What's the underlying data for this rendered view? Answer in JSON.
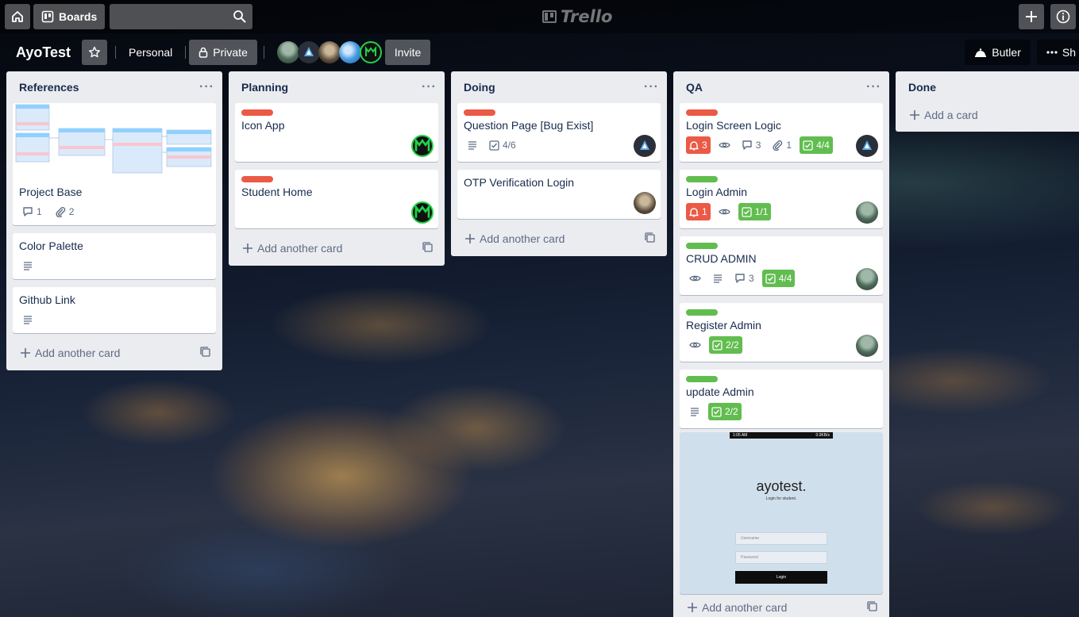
{
  "top_header": {
    "boards_label": "Boards",
    "search_placeholder": "",
    "logo_text": "Trello"
  },
  "board": {
    "title": "AyoTest",
    "team_label": "Personal",
    "visibility_label": "Private",
    "invite_label": "Invite",
    "butler_label": "Butler",
    "show_menu_label": "Sh"
  },
  "lists": [
    {
      "title": "References",
      "add_label": "Add another card",
      "cards": [
        {
          "title": "Project Base",
          "comments": "1",
          "attachments": "2"
        },
        {
          "title": "Color Palette"
        },
        {
          "title": "Github Link"
        }
      ]
    },
    {
      "title": "Planning",
      "add_label": "Add another card",
      "cards": [
        {
          "title": "Icon App",
          "label_color": "#eb5a46"
        },
        {
          "title": "Student Home",
          "label_color": "#eb5a46"
        }
      ]
    },
    {
      "title": "Doing",
      "add_label": "Add another card",
      "cards": [
        {
          "title": "Question Page [Bug Exist]",
          "label_color": "#eb5a46",
          "checklist": "4/6"
        },
        {
          "title": "OTP Verification Login"
        }
      ]
    },
    {
      "title": "QA",
      "add_label": "Add another card",
      "cards": [
        {
          "title": "Login Screen Logic",
          "label_color": "#eb5a46",
          "due": "3",
          "comments": "3",
          "attachments": "1",
          "checklist": "4/4"
        },
        {
          "title": "Login Admin",
          "label_color": "#61bd4f",
          "due": "1",
          "checklist": "1/1"
        },
        {
          "title": "CRUD ADMIN",
          "label_color": "#61bd4f",
          "comments": "3",
          "checklist": "4/4"
        },
        {
          "title": "Register Admin",
          "label_color": "#61bd4f",
          "checklist": "2/2"
        },
        {
          "title": "update Admin",
          "label_color": "#61bd4f",
          "checklist": "2/2"
        }
      ],
      "mockup": {
        "status_time": "1:05 AM",
        "status_speed": "0.0KB/s",
        "brand": "ayotest.",
        "tagline": "Login for student.",
        "username_placeholder": "Username",
        "password_placeholder": "Password",
        "login_label": "Login"
      }
    },
    {
      "title": "Done",
      "add_label": "Add a card",
      "cards": []
    }
  ],
  "colors": {
    "label_red": "#eb5a46",
    "label_green": "#61bd4f",
    "list_bg": "#ebecf0"
  },
  "icons": [
    "home-icon",
    "boards-icon",
    "search-icon",
    "plus-icon",
    "info-icon",
    "star-icon",
    "lock-icon",
    "butler-icon",
    "more-icon",
    "comment-icon",
    "attachment-icon",
    "description-icon",
    "checklist-icon",
    "watch-icon",
    "due-bell-icon",
    "template-icon"
  ]
}
